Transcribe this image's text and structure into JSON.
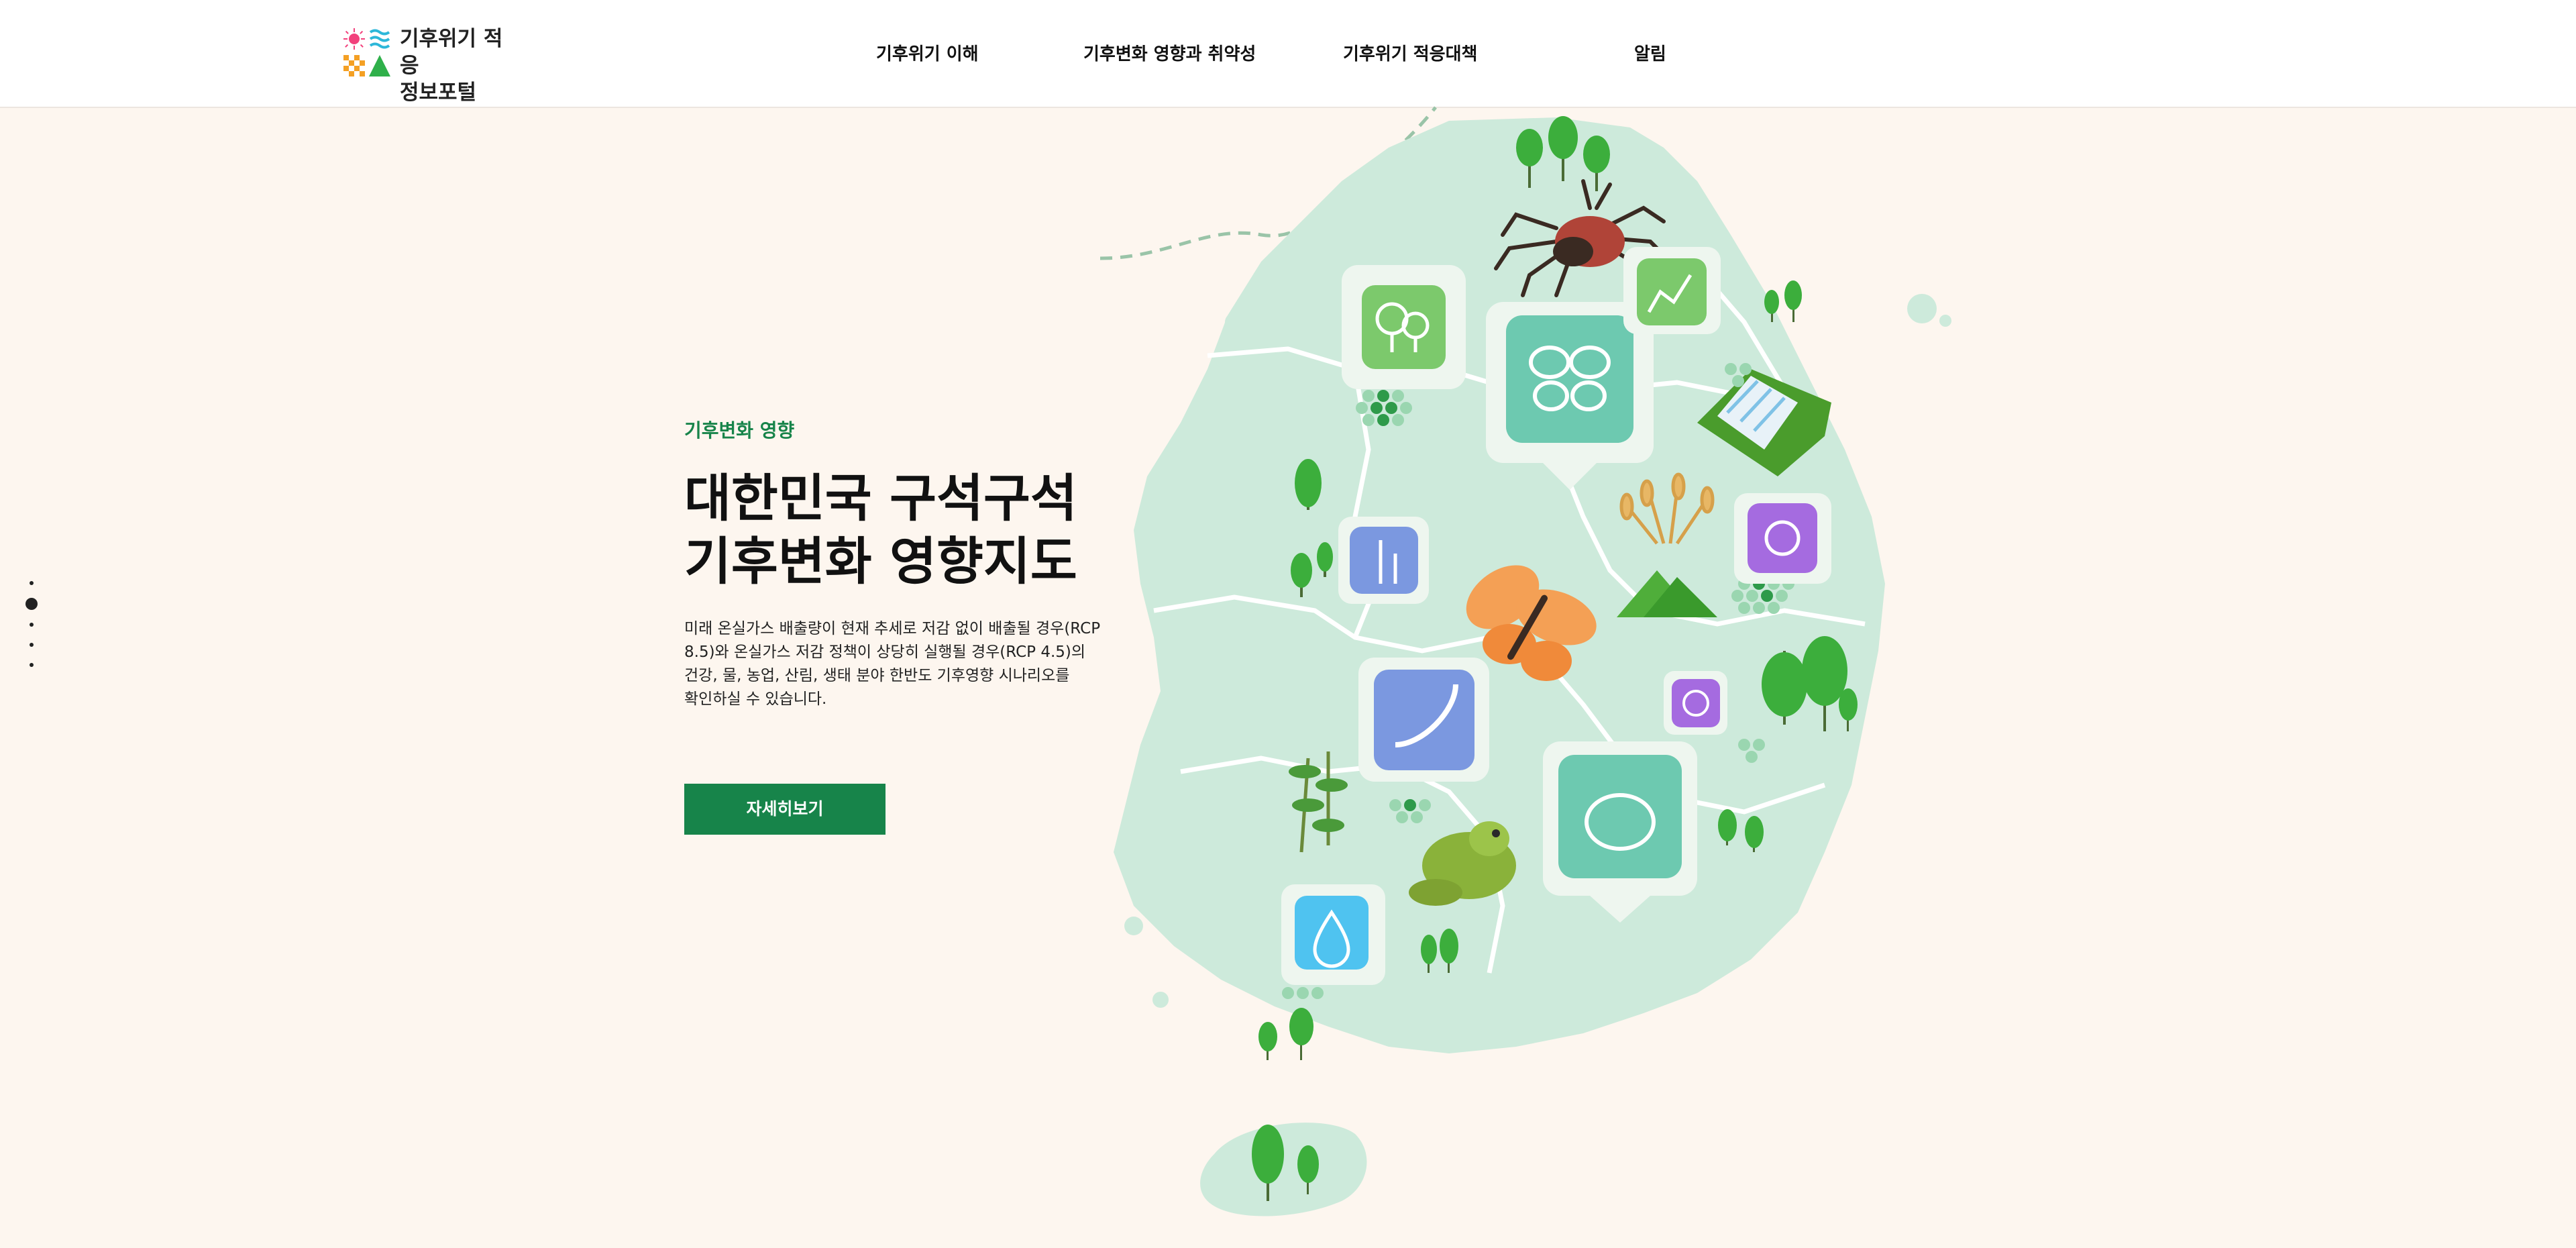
{
  "header": {
    "logo": {
      "line1": "기후위기 적응",
      "line2": "정보포털"
    },
    "nav": [
      "기후위기 이해",
      "기후변화 영향과 취약성",
      "기후위기 적응대책",
      "알림"
    ]
  },
  "hero": {
    "eyebrow": "기후변화 영향",
    "title_line1": "대한민국 구석구석",
    "title_line2": "기후변화 영향지도",
    "desc_lines": [
      "미래 온실가스 배출량이 현재 추세로 저감 없이 배출될 경우(RCP",
      "8.5)와 온실가스 저감 정책이 상당히 실행될 경우(RCP 4.5)의",
      "건강, 물, 농업, 산림, 생태 분야 한반도 기후영향 시나리오를",
      "확인하실 수 있습니다."
    ],
    "cta": "자세히보기"
  },
  "slider": {
    "count": 5,
    "active_index": 1
  },
  "colors": {
    "accent": "#17844a",
    "background": "#fdf6ef",
    "map_land": "#cdeadb",
    "map_road": "#ffffff",
    "tree": "#3cae3c",
    "icon_teal": "#6dc9b0",
    "icon_blue": "#7b98e0",
    "icon_purple": "#a56be0",
    "icon_green": "#7cc96c",
    "icon_sky": "#4fc3f0"
  },
  "map_icons": [
    "tree-icon",
    "butterfly-icon",
    "plant-growth-icon",
    "wheat-icon",
    "sun-icon",
    "bean-icon",
    "virus-icon",
    "frog-icon",
    "water-drop-icon"
  ],
  "map_illustrations": [
    "tick-illustration",
    "butterfly-illustration",
    "frog-illustration",
    "dam-illustration",
    "grain-illustration",
    "mountain-illustration"
  ]
}
